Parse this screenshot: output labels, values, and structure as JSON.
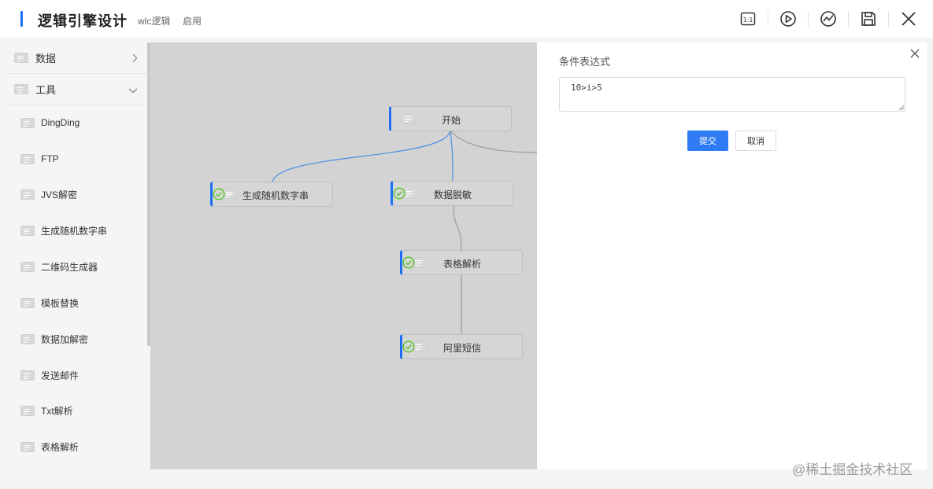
{
  "header": {
    "title": "逻辑引擎设计",
    "tag1": "wlc逻辑",
    "tag2": "启用",
    "accent": "#1e6ff5",
    "icons": [
      "fit-view-icon",
      "play-icon",
      "trend-icon",
      "save-icon",
      "close-icon"
    ]
  },
  "sidebar": {
    "groups": [
      {
        "label": "数据",
        "expanded": false
      },
      {
        "label": "工具",
        "expanded": true
      }
    ],
    "items": [
      {
        "label": "DingDing"
      },
      {
        "label": "FTP"
      },
      {
        "label": "JVS解密"
      },
      {
        "label": "生成随机数字串"
      },
      {
        "label": "二维码生成器"
      },
      {
        "label": "模板替换"
      },
      {
        "label": "数据加解密"
      },
      {
        "label": "发送邮件"
      },
      {
        "label": "Txt解析"
      },
      {
        "label": "表格解析"
      }
    ]
  },
  "canvas": {
    "nodes": [
      {
        "label": "开始",
        "status": ""
      },
      {
        "label": "生成随机数字串",
        "status": "success"
      },
      {
        "label": "数据脱敏",
        "status": "success"
      },
      {
        "label": "表格解析",
        "status": "success"
      },
      {
        "label": "阿里短信",
        "status": "success"
      }
    ],
    "status_color": "#52c41a",
    "link_color": "#4a90e2"
  },
  "panel": {
    "title": "条件表达式",
    "expression": "10>i>5",
    "submit_label": "提交",
    "cancel_label": "取消",
    "submit_color": "#2f7bf5"
  },
  "watermark": "@稀土掘金技术社区"
}
